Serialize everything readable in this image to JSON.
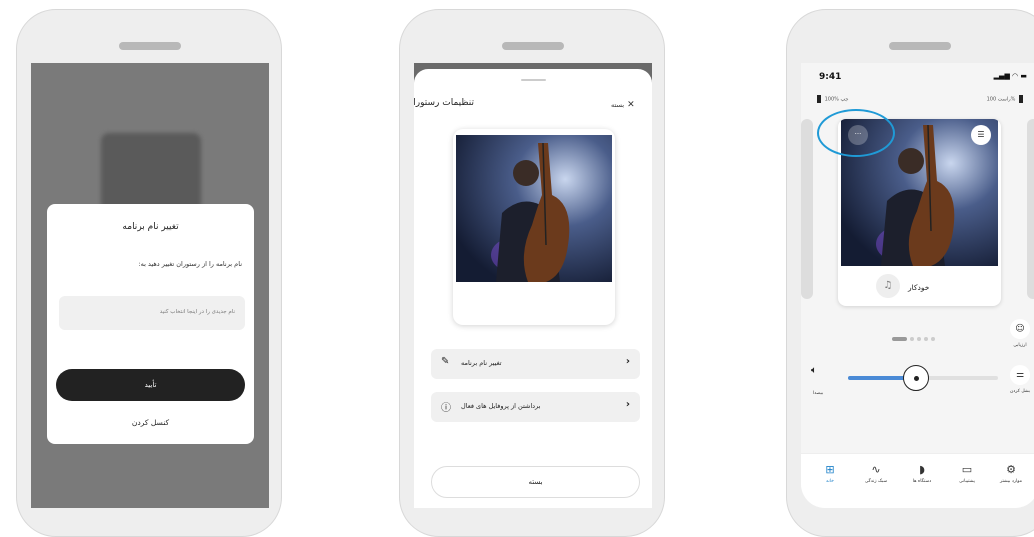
{
  "phone1": {
    "dialog": {
      "title": "تغییر نام برنامه",
      "message": "نام برنامه را از رستوران تغییر دهید به:",
      "placeholder": "نام جدیدی را در اینجا انتخاب کنید",
      "confirm": "تأیید",
      "cancel": "کنسل کردن"
    }
  },
  "phone2": {
    "close_label": "بسته",
    "title": "تنظیمات رستوران",
    "rows": [
      {
        "label": "تغییر نام برنامه",
        "icon": "pencil-icon"
      },
      {
        "label": "برداشتن از پروفایل های فعال",
        "icon": "info-icon"
      }
    ],
    "close_button": "بسته"
  },
  "phone3": {
    "time": "9:41",
    "battery_left": {
      "label": "چپ",
      "level": "100%"
    },
    "battery_right": {
      "label": "راست",
      "level": "100%"
    },
    "program_name": "خودکار",
    "rate_label": "ارزیابی",
    "mute_label": "بیصدا",
    "tune_label": "بشل کردن",
    "volume": 0.45,
    "tabs": [
      {
        "label": "خانه",
        "icon": "grid-icon",
        "active": true
      },
      {
        "label": "سبک زندگی",
        "icon": "activity-icon",
        "active": false
      },
      {
        "label": "دستگاه ها",
        "icon": "hearing-aid-icon",
        "active": false
      },
      {
        "label": "پشتیبانی",
        "icon": "chat-icon",
        "active": false
      },
      {
        "label": "موارد بیشتر",
        "icon": "gear-icon",
        "active": false
      }
    ],
    "accent": "#1f82c9"
  }
}
